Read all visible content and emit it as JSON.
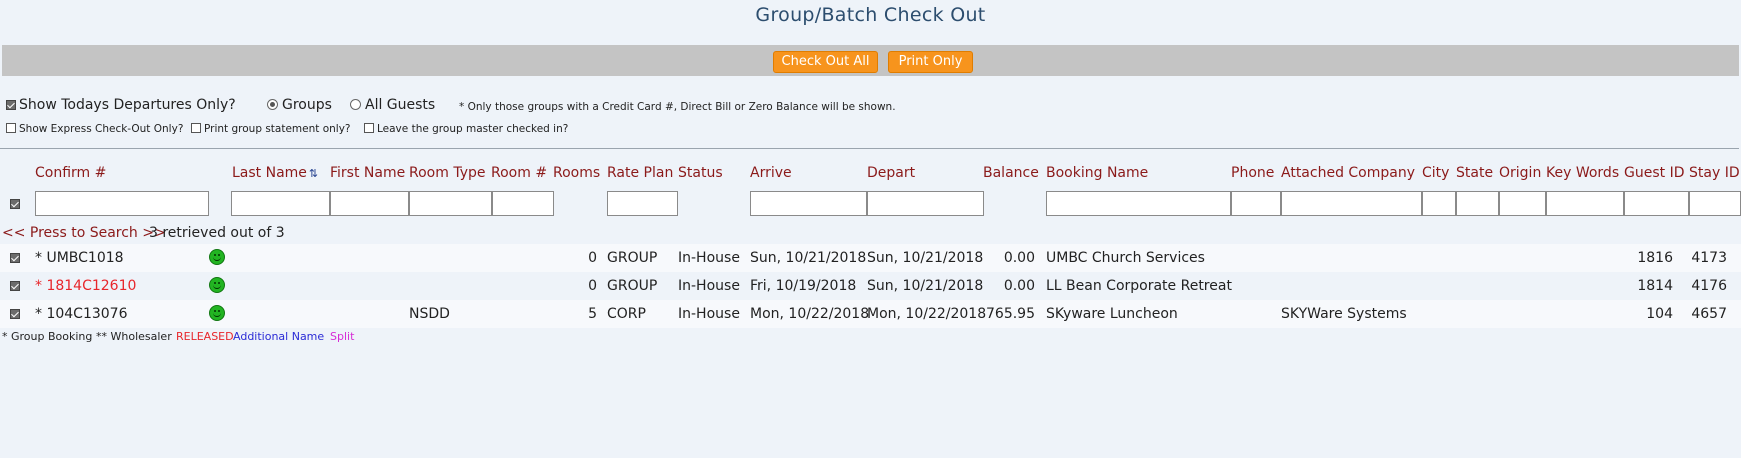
{
  "page": {
    "title": "Group/Batch Check Out"
  },
  "toolbar": {
    "check_out_all": "Check Out All",
    "print_only": "Print Only"
  },
  "options": {
    "todays_departures": "Show Todays Departures Only?",
    "groups": "Groups",
    "all_guests": "All Guests",
    "note": "* Only those groups with a Credit Card #, Direct Bill or Zero Balance will be shown.",
    "express": "Show Express Check-Out Only?",
    "print_statement": "Print group statement only?",
    "leave_master": "Leave the group master checked in?"
  },
  "table": {
    "headers": {
      "confirm": "Confirm #",
      "last_name": "Last Name",
      "first_name": "First Name",
      "room_type": "Room Type",
      "room_no": "Room #",
      "rooms": "Rooms",
      "rate_plan": "Rate Plan",
      "status": "Status",
      "arrive": "Arrive",
      "depart": "Depart",
      "balance": "Balance",
      "booking_name": "Booking Name",
      "phone": "Phone",
      "attached_company": "Attached Company",
      "city": "City",
      "state": "State",
      "origin": "Origin",
      "key_words": "Key Words",
      "guest_id": "Guest ID",
      "stay_id": "Stay ID"
    },
    "search_link": "<< Press to Search >>",
    "retrieved": "3 retrieved out of 3",
    "rows": [
      {
        "confirm": "* UMBC1018",
        "room_type": "",
        "rooms": "0",
        "rate_plan": "GROUP",
        "status": "In-House",
        "arrive": "Sun, 10/21/2018",
        "depart": "Sun, 10/21/2018",
        "balance": "0.00",
        "booking_name": "UMBC Church Services",
        "attached_company": "",
        "guest_id": "1816",
        "stay_id": "4173"
      },
      {
        "confirm": "* 1814C12610",
        "room_type": "",
        "rooms": "0",
        "rate_plan": "GROUP",
        "status": "In-House",
        "arrive": "Fri, 10/19/2018",
        "depart": "Sun, 10/21/2018",
        "balance": "0.00",
        "booking_name": "LL Bean Corporate Retreat",
        "attached_company": "",
        "guest_id": "1814",
        "stay_id": "4176"
      },
      {
        "confirm": "* 104C13076",
        "room_type": "NSDD",
        "rooms": "5",
        "rate_plan": "CORP",
        "status": "In-House",
        "arrive": "Mon, 10/22/2018",
        "depart": "Mon, 10/22/2018",
        "balance": "765.95",
        "booking_name": "SKyware Luncheon",
        "attached_company": "SKYWare Systems",
        "guest_id": "104",
        "stay_id": "4657"
      }
    ]
  },
  "legend": {
    "group_booking": "* Group Booking",
    "wholesaler": "** Wholesaler",
    "released": "RELEASED",
    "additional_name": "Additional Name",
    "split": "Split"
  },
  "colors": {
    "header_text": "#8b1a1a",
    "button": "#f7941d",
    "released": "#e8262b",
    "additional_name": "#2b2bd6",
    "split": "#d62bd6"
  }
}
